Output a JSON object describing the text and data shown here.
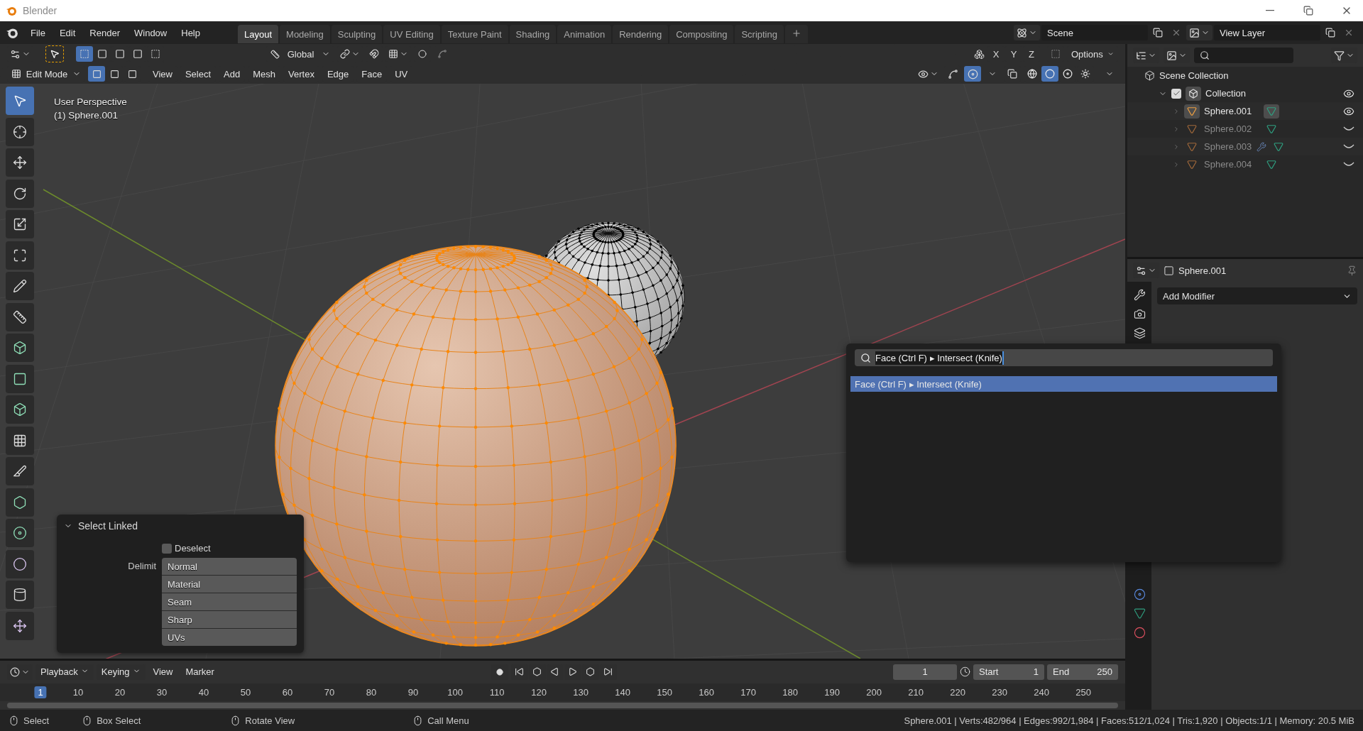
{
  "window": {
    "title": "Blender"
  },
  "menu": [
    "File",
    "Edit",
    "Render",
    "Window",
    "Help"
  ],
  "workspaces": [
    {
      "label": "Layout",
      "selected": true
    },
    {
      "label": "Modeling",
      "selected": false
    },
    {
      "label": "Sculpting",
      "selected": false
    },
    {
      "label": "UV Editing",
      "selected": false
    },
    {
      "label": "Texture Paint",
      "selected": false
    },
    {
      "label": "Shading",
      "selected": false
    },
    {
      "label": "Animation",
      "selected": false
    },
    {
      "label": "Rendering",
      "selected": false
    },
    {
      "label": "Compositing",
      "selected": false
    },
    {
      "label": "Scripting",
      "selected": false
    }
  ],
  "scene": {
    "name": "Scene"
  },
  "view_layer": {
    "name": "View Layer"
  },
  "tool_header": {
    "select_box_modes": [
      {
        "selected": true
      },
      {
        "selected": false
      },
      {
        "selected": false
      },
      {
        "selected": false
      },
      {
        "selected": false
      }
    ],
    "orientation": "Global",
    "axes": [
      {
        "label": "X"
      },
      {
        "label": "Y"
      },
      {
        "label": "Z"
      }
    ],
    "options": "Options"
  },
  "view_header": {
    "mode": "Edit Mode",
    "select_modes": [
      {
        "selected": true
      },
      {
        "selected": false
      },
      {
        "selected": false
      }
    ],
    "menus": [
      "View",
      "Select",
      "Add",
      "Mesh",
      "Vertex",
      "Edge",
      "Face",
      "UV"
    ],
    "overlays": {
      "on": true
    },
    "shading": [
      {
        "selected": false
      },
      {
        "selected": true
      },
      {
        "selected": false
      },
      {
        "selected": false
      }
    ]
  },
  "viewport": {
    "info": [
      "User Perspective",
      "(1) Sphere.001"
    ]
  },
  "tools": [
    {
      "selected": true
    },
    {
      "selected": false
    },
    {
      "selected": false
    },
    {
      "selected": false
    },
    {
      "selected": false
    },
    {
      "selected": false
    },
    {
      "selected": false
    },
    {
      "selected": false
    },
    {
      "selected": false
    },
    {
      "selected": false
    },
    {
      "selected": false
    },
    {
      "selected": false
    },
    {
      "selected": false
    },
    {
      "selected": false
    },
    {
      "selected": false
    },
    {
      "selected": false
    },
    {
      "selected": false
    },
    {
      "selected": false
    }
  ],
  "operator_panel": {
    "title": "Select Linked",
    "expanded": true,
    "deselect": {
      "label": "Deselect",
      "checked": false
    },
    "delimit_label": "Delimit",
    "delimit": [
      "Normal",
      "Material",
      "Seam",
      "Sharp",
      "UVs"
    ]
  },
  "search": {
    "value": "Face (Ctrl F) ▸ Intersect (Knife)",
    "results": [
      {
        "label": "Face (Ctrl F) ▸ Intersect (Knife)",
        "selected": true
      }
    ]
  },
  "outliner": {
    "root": "Scene Collection",
    "collections": [
      {
        "label": "Collection",
        "checked": true,
        "expanded": true,
        "visible": true,
        "children": [
          {
            "label": "Sphere.001",
            "selected": true,
            "visible": true,
            "modifier": false
          },
          {
            "label": "Sphere.002",
            "selected": false,
            "visible": false,
            "modifier": false
          },
          {
            "label": "Sphere.003",
            "selected": false,
            "visible": false,
            "modifier": true
          },
          {
            "label": "Sphere.004",
            "selected": false,
            "visible": false,
            "modifier": false
          }
        ]
      }
    ]
  },
  "properties": {
    "object": "Sphere.001",
    "add_modifier": "Add Modifier"
  },
  "timeline": {
    "menus": [
      {
        "label": "Playback",
        "dropdown": true
      },
      {
        "label": "Keying",
        "dropdown": true
      },
      {
        "label": "View",
        "dropdown": false
      },
      {
        "label": "Marker",
        "dropdown": false
      }
    ],
    "current_frame": "1",
    "start_label": "Start",
    "start": "1",
    "end_label": "End",
    "end": "250",
    "ruler": [
      {
        "label": "1",
        "selected": true
      },
      {
        "label": "10",
        "selected": false
      },
      {
        "label": "20",
        "selected": false
      },
      {
        "label": "30",
        "selected": false
      },
      {
        "label": "40",
        "selected": false
      },
      {
        "label": "50",
        "selected": false
      },
      {
        "label": "60",
        "selected": false
      },
      {
        "label": "70",
        "selected": false
      },
      {
        "label": "80",
        "selected": false
      },
      {
        "label": "90",
        "selected": false
      },
      {
        "label": "100",
        "selected": false
      },
      {
        "label": "110",
        "selected": false
      },
      {
        "label": "120",
        "selected": false
      },
      {
        "label": "130",
        "selected": false
      },
      {
        "label": "140",
        "selected": false
      },
      {
        "label": "150",
        "selected": false
      },
      {
        "label": "160",
        "selected": false
      },
      {
        "label": "170",
        "selected": false
      },
      {
        "label": "180",
        "selected": false
      },
      {
        "label": "190",
        "selected": false
      },
      {
        "label": "200",
        "selected": false
      },
      {
        "label": "210",
        "selected": false
      },
      {
        "label": "220",
        "selected": false
      },
      {
        "label": "230",
        "selected": false
      },
      {
        "label": "240",
        "selected": false
      },
      {
        "label": "250",
        "selected": false
      }
    ]
  },
  "status_bar": {
    "hints": [
      "Select",
      "Box Select",
      "Rotate View",
      "Call Menu"
    ],
    "stats": "Sphere.001 | Verts:482/964 | Edges:992/1,984 | Faces:512/1,024 | Tris:1,920 | Objects:1/1 | Memory: 20.5 MiB"
  }
}
